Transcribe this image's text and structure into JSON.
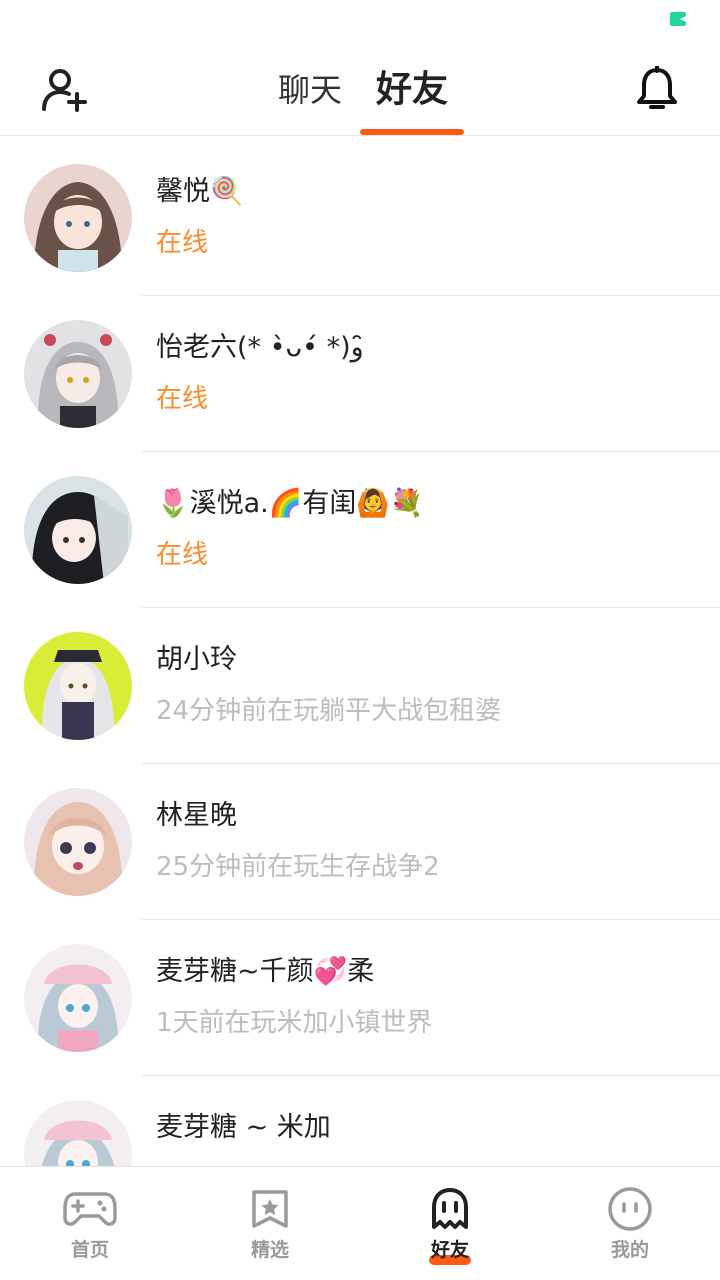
{
  "header": {
    "tabs": [
      {
        "label": "聊天",
        "active": false
      },
      {
        "label": "好友",
        "active": true
      }
    ],
    "add_friend_icon": "add-user-icon",
    "notification_icon": "bell-icon"
  },
  "friends": [
    {
      "name": "馨悦🍭",
      "status": "在线",
      "online": true
    },
    {
      "name": "怡老六(* •̀ᴗ•́ *)و ̑̑",
      "status": "在线",
      "online": true
    },
    {
      "name": "🌷溪悦a.🌈有闺🙆💐",
      "status": "在线",
      "online": true
    },
    {
      "name": "胡小玲",
      "status": "24分钟前在玩躺平大战包租婆",
      "online": false
    },
    {
      "name": "林星晚",
      "status": "25分钟前在玩生存战争2",
      "online": false
    },
    {
      "name": "麦芽糖~千颜💞柔",
      "status": "1天前在玩米加小镇世界",
      "online": false
    },
    {
      "name": "麦芽糖 ~ 米加",
      "status": "",
      "online": false
    }
  ],
  "bottom_nav": [
    {
      "label": "首页",
      "icon": "gamepad-icon",
      "active": false
    },
    {
      "label": "精选",
      "icon": "star-bookmark-icon",
      "active": false
    },
    {
      "label": "好友",
      "icon": "ghost-icon",
      "active": true
    },
    {
      "label": "我的",
      "icon": "face-icon",
      "active": false
    }
  ],
  "colors": {
    "accent": "#ff5a14",
    "online": "#ff8a2a",
    "status_indicator": "#1fd6a0"
  }
}
